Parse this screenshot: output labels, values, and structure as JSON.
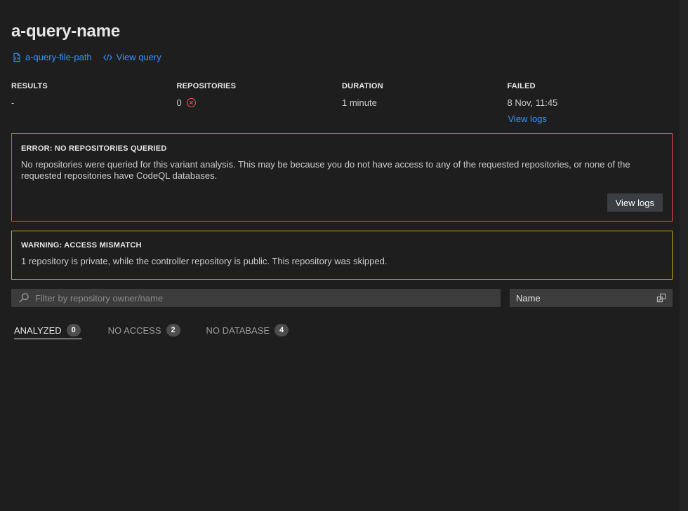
{
  "query": {
    "name": "a-query-name",
    "file_path_link": "a-query-file-path",
    "view_query_link": "View query"
  },
  "stats": {
    "results": {
      "label": "RESULTS",
      "value": "-"
    },
    "repositories": {
      "label": "REPOSITORIES",
      "value": "0"
    },
    "duration": {
      "label": "DURATION",
      "value": "1 minute"
    },
    "status": {
      "label": "FAILED",
      "value": "8 Nov, 11:45",
      "link": "View logs"
    }
  },
  "alerts": {
    "error": {
      "title": "ERROR: NO REPOSITORIES QUERIED",
      "message": "No repositories were queried for this variant analysis. This may be because you do not have access to any of the requested repositories, or none of the requested repositories have CodeQL databases.",
      "button_label": "View logs"
    },
    "warning": {
      "title": "WARNING: ACCESS MISMATCH",
      "message": "1 repository is private, while the controller repository is public. This repository was skipped."
    }
  },
  "filter": {
    "placeholder": "Filter by repository owner/name",
    "value": "",
    "sort_label": "Name"
  },
  "tabs": [
    {
      "label": "ANALYZED",
      "count": "0",
      "active": true
    },
    {
      "label": "NO ACCESS",
      "count": "2",
      "active": false
    },
    {
      "label": "NO DATABASE",
      "count": "4",
      "active": false
    }
  ],
  "colors": {
    "background": "#1e1e1e",
    "link": "#3794ff",
    "error": "#f14c4c",
    "warning": "#cca700"
  }
}
